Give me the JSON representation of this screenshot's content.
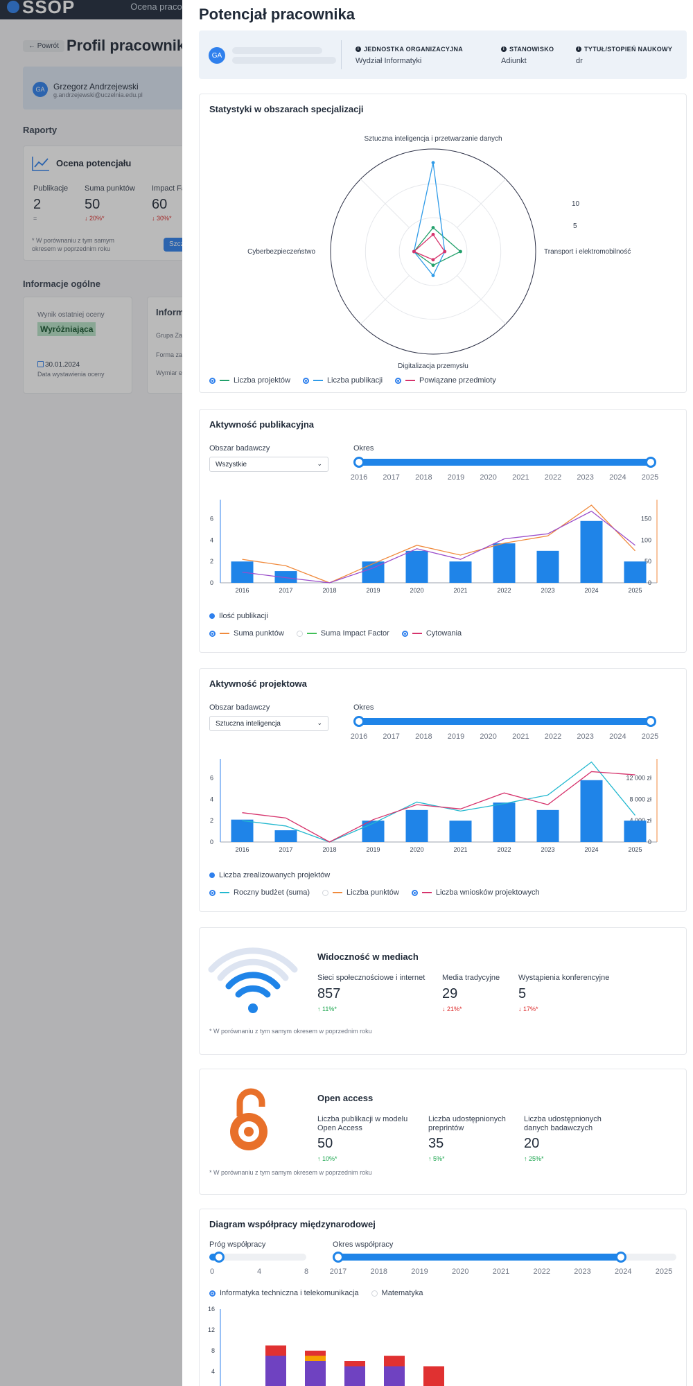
{
  "background": {
    "logo": "SSOP",
    "nav_item": "Ocena praco",
    "back_label": "← Powrót",
    "page_title": "Profil pracownika",
    "user": {
      "initials": "GA",
      "name": "Grzegorz Andrzejewski",
      "email": "g.andrzejewski@uczelnia.edu.pl"
    },
    "reports_heading": "Raporty",
    "report_card": {
      "title": "Ocena potencjału",
      "stats": [
        {
          "label": "Publikacje",
          "value": "2",
          "change": "="
        },
        {
          "label": "Suma punktów",
          "value": "50",
          "change": "↓ 20%*"
        },
        {
          "label": "Impact Fa",
          "value": "60",
          "change": "↓ 30%*"
        }
      ],
      "note": "* W porównaniu z tym samym okresem w poprzednim roku",
      "button": "Szcz"
    },
    "general_heading": "Informacje ogólne",
    "last_rating": {
      "label": "Wynik ostatniej oceny",
      "badge": "Wyróżniająca",
      "date": "30.01.2024",
      "date_label": "Data wystawienia oceny"
    },
    "info_card": {
      "title": "Inform",
      "rows": [
        "Grupa Za",
        "Forma za",
        "Wymiar e"
      ]
    }
  },
  "drawer": {
    "title": "Potencjał pracownika",
    "employee": {
      "initials": "GA",
      "fields": [
        {
          "key": "JEDNOSTKA ORGANIZACYJNA",
          "value": "Wydział Informatyki"
        },
        {
          "key": "STANOWISKO",
          "value": "Adiunkt"
        },
        {
          "key": "TYTUŁ/STOPIEŃ NAUKOWY",
          "value": "dr"
        }
      ]
    },
    "radar": {
      "title": "Statystyki w obszarach specjalizacji",
      "legend": [
        "Liczba projektów",
        "Liczba publikacji",
        "Powiązane przedmioty"
      ]
    },
    "publications": {
      "title": "Aktywność publikacyjna",
      "area_label": "Obszar badawczy",
      "area_value": "Wszystkie",
      "period_label": "Okres",
      "legend_bar": "Ilość publikacji",
      "legend_lines": [
        "Suma punktów",
        "Suma Impact Factor",
        "Cytowania"
      ]
    },
    "projects": {
      "title": "Aktywność projektowa",
      "area_label": "Obszar badawczy",
      "area_value": "Sztuczna inteligencja",
      "period_label": "Okres",
      "legend_bar": "Liczba zrealizowanych projektów",
      "legend_lines": [
        "Roczny budżet (suma)",
        "Liczba punktów",
        "Liczba wniosków projektowych"
      ]
    },
    "media": {
      "title": "Widoczność w mediach",
      "stats": [
        {
          "label": "Sieci społecznościowe i internet",
          "value": "857",
          "change": "↑ 11%*",
          "dir": "up"
        },
        {
          "label": "Media tradycyjne",
          "value": "29",
          "change": "↓ 21%*",
          "dir": "down"
        },
        {
          "label": "Wystąpienia konferencyjne",
          "value": "5",
          "change": "↓ 17%*",
          "dir": "down"
        }
      ],
      "note": "* W porównaniu z tym samym okresem w poprzednim roku"
    },
    "open_access": {
      "title": "Open access",
      "stats": [
        {
          "label": "Liczba publikacji w modelu Open Access",
          "value": "50",
          "change": "↑ 10%*",
          "dir": "up"
        },
        {
          "label": "Liczba udostępnionych preprintów",
          "value": "35",
          "change": "↑ 5%*",
          "dir": "up"
        },
        {
          "label": "Liczba udostępnionych danych badawczych",
          "value": "20",
          "change": "↑ 25%*",
          "dir": "up"
        }
      ],
      "note": "* W porównaniu z tym samym okresem w poprzednim roku"
    },
    "cooperation": {
      "title": "Diagram współpracy międzynarodowej",
      "threshold_label": "Próg współpracy",
      "threshold_ticks": [
        "0",
        "4",
        "8"
      ],
      "period_label": "Okres współpracy",
      "period_ticks": [
        "2017",
        "2018",
        "2019",
        "2020",
        "2021",
        "2022",
        "2023",
        "2024",
        "2025"
      ],
      "legend": [
        "Informatyka techniczna i telekomunikacja",
        "Matematyka"
      ]
    }
  },
  "chart_data": [
    {
      "type": "radar",
      "title": "Statystyki w obszarach specjalizacji",
      "axes": [
        "Sztuczna inteligencja i przetwarzanie danych",
        "Transport i elektromobilność",
        "Digitalizacja przemysłu",
        "Cyberbezpieczeństwo"
      ],
      "rticks": [
        "5",
        "10"
      ],
      "rmax": 15,
      "series": [
        {
          "name": "Liczba projektów",
          "color": "#22a06b",
          "values": [
            3.5,
            4,
            2,
            2.8
          ]
        },
        {
          "name": "Liczba publikacji",
          "color": "#2f9be8",
          "values": [
            13,
            1.7,
            3.5,
            2.8
          ]
        },
        {
          "name": "Powiązane przedmioty",
          "color": "#d6336c",
          "values": [
            2.5,
            1.7,
            1.2,
            2.8
          ]
        }
      ]
    },
    {
      "type": "bar",
      "title": "Aktywność publikacyjna",
      "categories": [
        "2016",
        "2017",
        "2018",
        "2019",
        "2020",
        "2021",
        "2022",
        "2023",
        "2024",
        "2025"
      ],
      "y_ticks": [
        "0",
        "2",
        "4",
        "6"
      ],
      "y2_ticks": [
        "0",
        "50",
        "100",
        "150"
      ],
      "ylim": [
        0,
        7.8
      ],
      "y2lim": [
        0,
        195
      ],
      "bars": {
        "name": "Ilość publikacji",
        "values": [
          2,
          1.1,
          0,
          2,
          3,
          2,
          3.7,
          3,
          5.8,
          2
        ]
      },
      "lines": [
        {
          "name": "Suma punktów",
          "color": "#f08a3c",
          "values": [
            55,
            40,
            0,
            45,
            88,
            65,
            93,
            110,
            182,
            75
          ]
        },
        {
          "name": "Cytowania",
          "color": "#9b4dca",
          "values": [
            25,
            12,
            0,
            35,
            80,
            55,
            103,
            115,
            168,
            88
          ]
        }
      ]
    },
    {
      "type": "bar",
      "title": "Aktywność projektowa",
      "categories": [
        "2016",
        "2017",
        "2018",
        "2019",
        "2020",
        "2021",
        "2022",
        "2023",
        "2024",
        "2025"
      ],
      "y_ticks": [
        "0",
        "2",
        "4",
        "6"
      ],
      "y2_ticks": [
        "0",
        "4 000 zł",
        "8 000 zł",
        "12 000 zł"
      ],
      "ylim": [
        0,
        7.8
      ],
      "y2lim": [
        0,
        15600
      ],
      "bars": {
        "name": "Liczba zrealizowanych projektów",
        "values": [
          2.1,
          1.1,
          0,
          2,
          3,
          2,
          3.7,
          3,
          5.8,
          2
        ]
      },
      "lines": [
        {
          "name": "Roczny budżet (suma)",
          "color": "#22b8cf",
          "values": [
            4000,
            3000,
            0,
            3500,
            7500,
            5800,
            7200,
            8800,
            15000,
            5000
          ]
        },
        {
          "name": "Liczba wniosków projektowych",
          "color": "#d6336c",
          "values": [
            5500,
            4500,
            0,
            4200,
            7000,
            6200,
            9200,
            7000,
            13200,
            12600
          ]
        }
      ]
    },
    {
      "type": "bar",
      "title": "Diagram współpracy międzynarodowej",
      "y_ticks": [
        "4",
        "8",
        "12",
        "16"
      ],
      "ylim": [
        0,
        16
      ],
      "stacks": [
        {
          "values": [
            7,
            2
          ],
          "colors": [
            "#6f42c1",
            "#e03131"
          ]
        },
        {
          "values": [
            6,
            1,
            1
          ],
          "colors": [
            "#6f42c1",
            "#f59f00",
            "#e03131"
          ]
        },
        {
          "values": [
            5,
            1
          ],
          "colors": [
            "#6f42c1",
            "#e03131"
          ]
        },
        {
          "values": [
            5,
            2
          ],
          "colors": [
            "#6f42c1",
            "#e03131"
          ]
        },
        {
          "values": [
            5
          ],
          "colors": [
            "#e03131"
          ]
        }
      ]
    }
  ]
}
